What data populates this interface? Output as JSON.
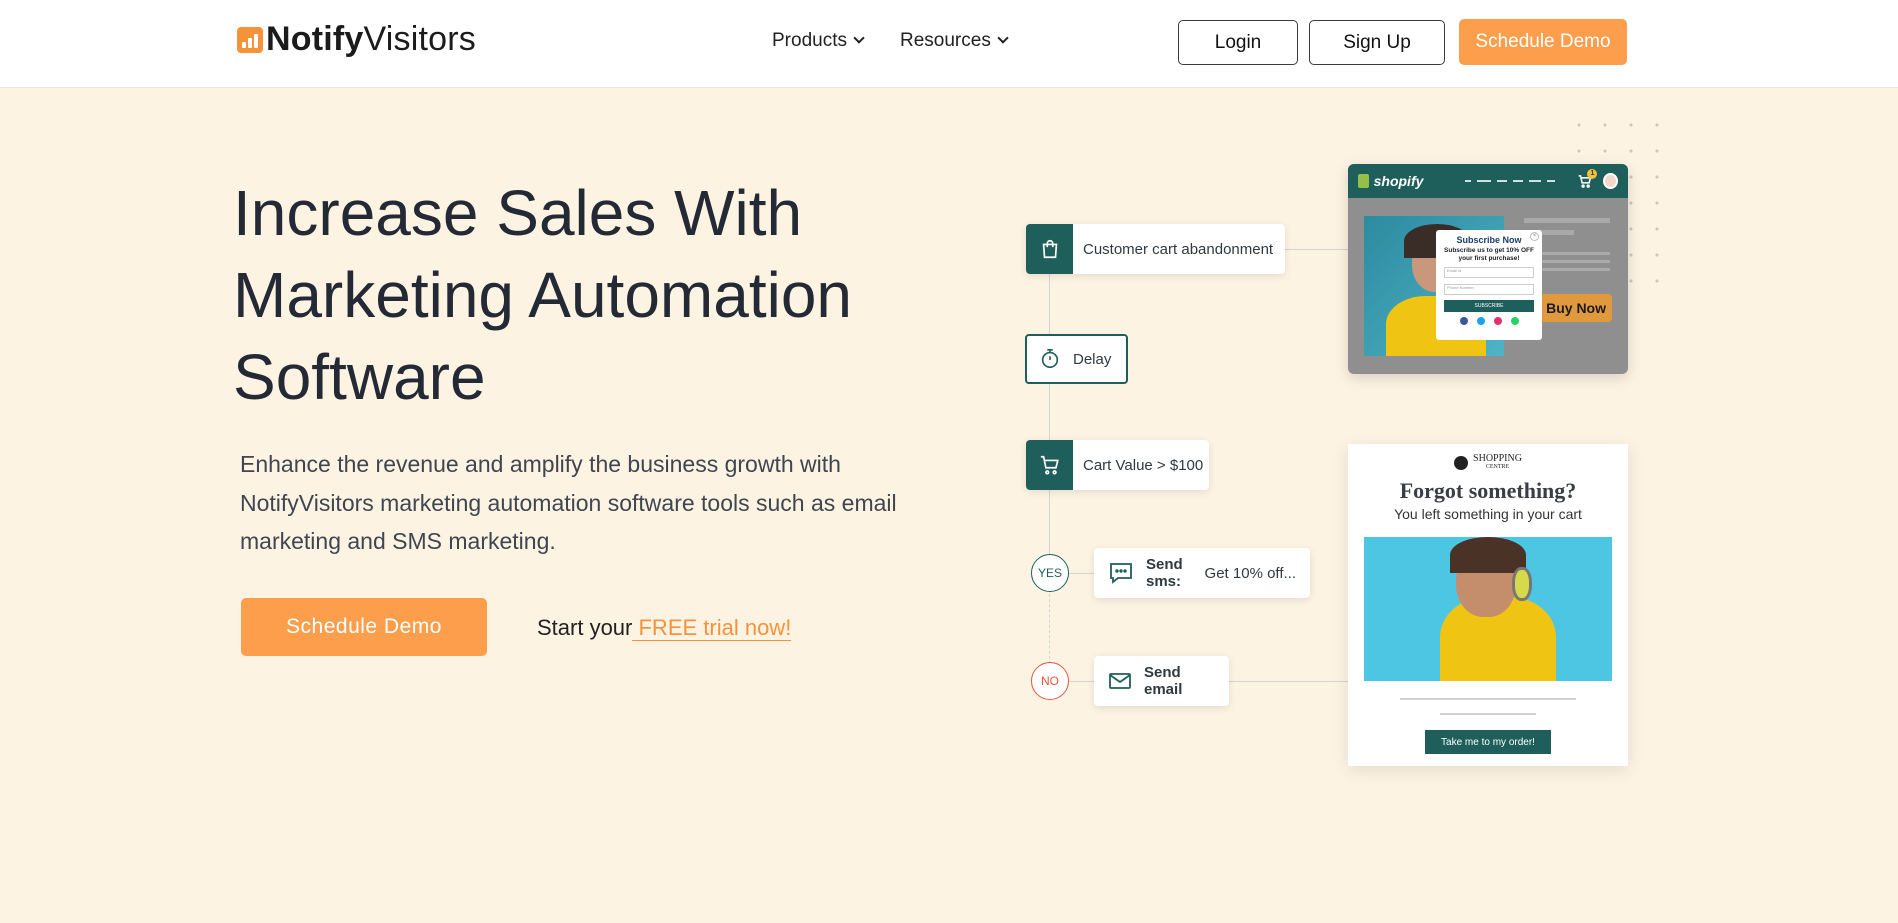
{
  "header": {
    "logo_bold": "Notify",
    "logo_regular": "Visitors",
    "nav": [
      {
        "label": "Products"
      },
      {
        "label": "Resources"
      }
    ],
    "login_label": "Login",
    "signup_label": "Sign Up",
    "schedule_demo_label": "Schedule Demo"
  },
  "hero": {
    "title_lines": [
      "Increase Sales With",
      "Marketing Automation",
      "Software"
    ],
    "subtitle": "Enhance the revenue and amplify the business growth with NotifyVisitors marketing automation software tools such as email marketing and SMS marketing.",
    "cta_label": "Schedule Demo",
    "trial_prefix": "Start your",
    "trial_link": " FREE trial now!"
  },
  "workflow": {
    "trigger": "Customer cart abandonment",
    "delay": "Delay",
    "condition": "Cart Value > $100",
    "yes_label": "YES",
    "no_label": "NO",
    "sms_bold": "Send sms:",
    "sms_text": " Get 10% off...",
    "email_label": "Send email"
  },
  "shopify_card": {
    "brand": "shopify",
    "cart_badge": "1",
    "popup_title": "Subscribe Now",
    "popup_sub": "Subscribe us to get 10% OFF your first purchase!",
    "email_placeholder": "Email id",
    "phone_placeholder": "Phone Number",
    "subscribe_label": "SUBSCRIBE",
    "buy_now": "Buy Now"
  },
  "email_card": {
    "brand_top": "SHOPPING",
    "brand_bottom": "CENTRE",
    "title": "Forgot something?",
    "subtitle": "You left something in your cart",
    "button": "Take me to my order!"
  },
  "colors": {
    "accent": "#fd9e4d",
    "teal": "#1f5f5b",
    "background": "#fdf3e3",
    "no_red": "#e8553a"
  }
}
